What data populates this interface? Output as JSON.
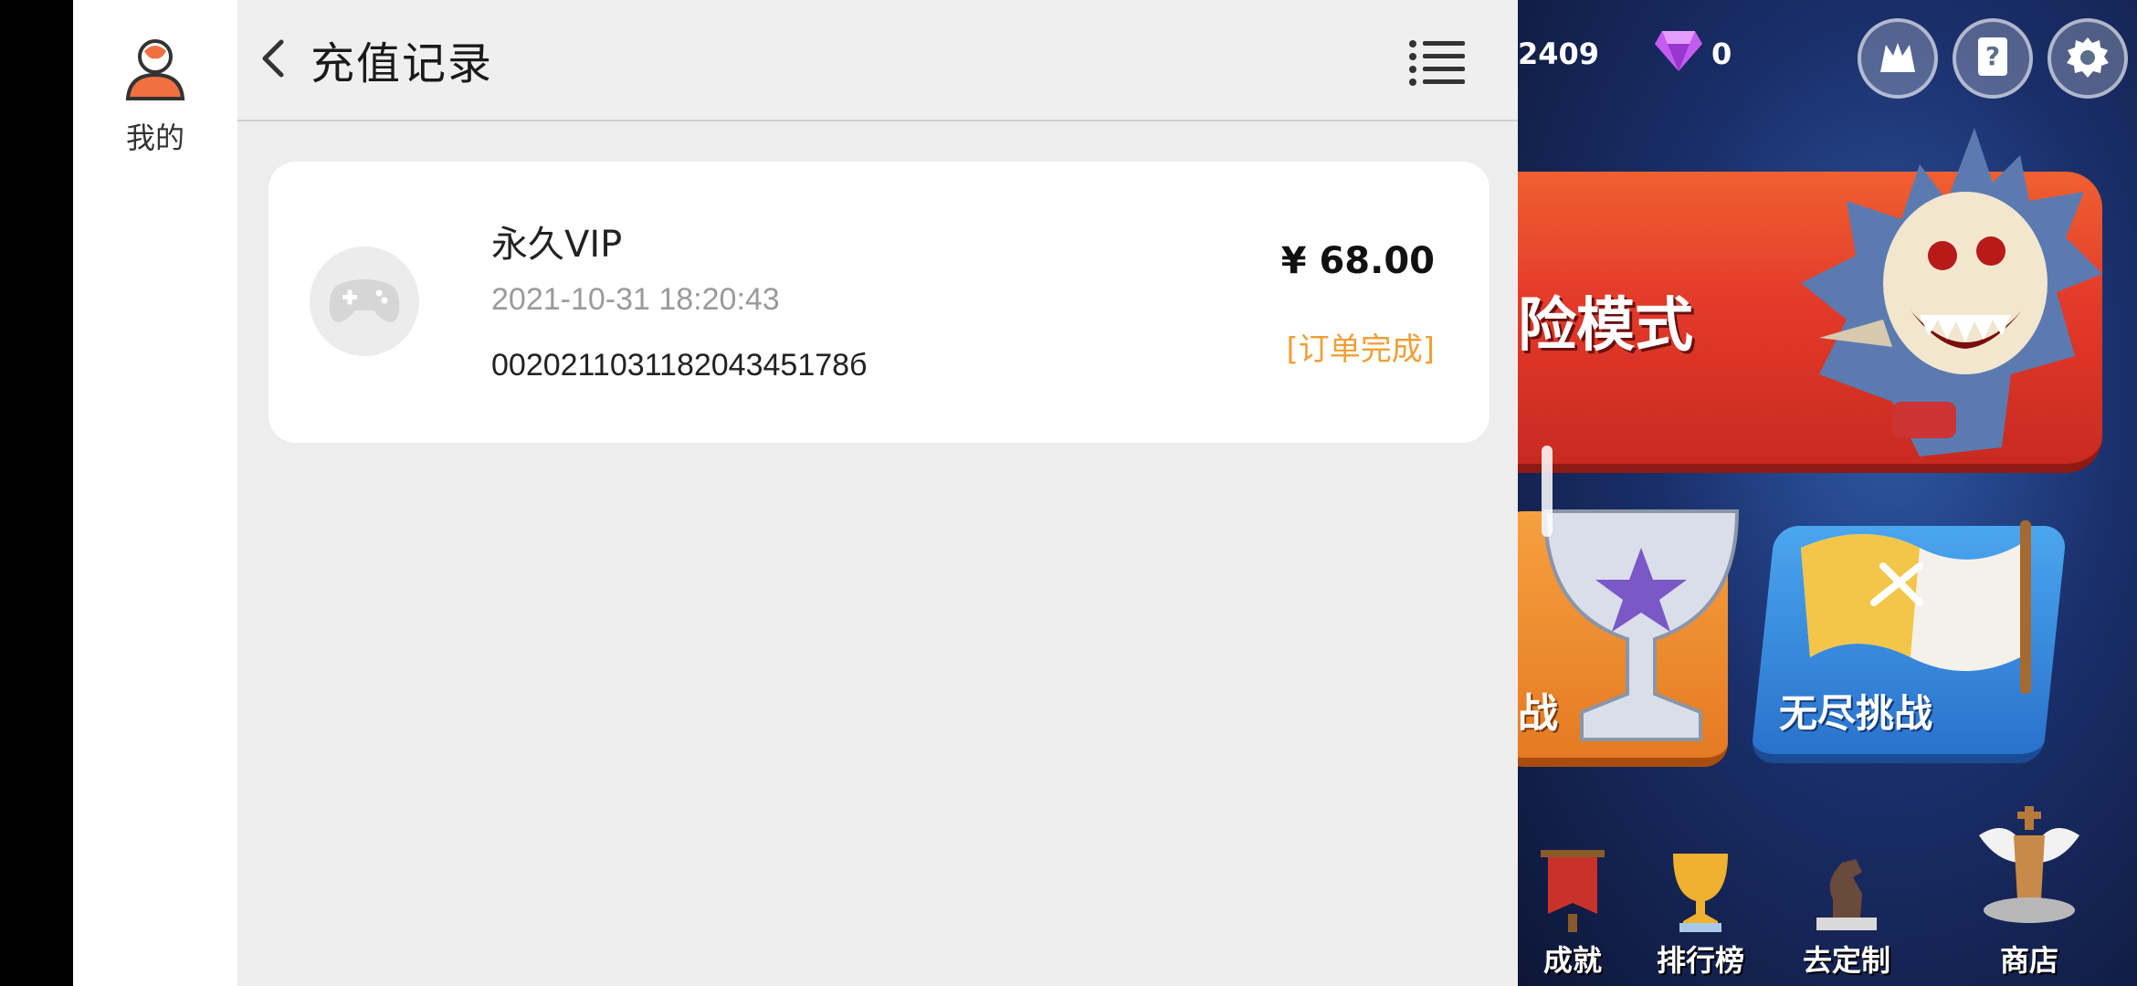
{
  "sidebar": {
    "item_label": "我的"
  },
  "header": {
    "title": "充值记录"
  },
  "record": {
    "name": "永久VIP",
    "time": "2021-10-31 18:20:43",
    "order_no": "002021103118204345178б",
    "amount": "¥ 68.00",
    "status": "[订单完成]"
  },
  "game": {
    "score": "2409",
    "gems": "0",
    "adventure_label": "险模式",
    "trophy_partial": "战",
    "endless_label": "无尽挑战",
    "nav": [
      "成就",
      "排行榜",
      "去定制",
      "商店"
    ]
  },
  "colors": {
    "status_orange": "#f0a038",
    "panel_bg": "#ededed",
    "card_bg": "#ffffff"
  },
  "icons": {
    "avatar": "user-avatar-icon",
    "back": "chevron-left-icon",
    "menu": "list-menu-icon",
    "game": "gamepad-icon",
    "gem": "diamond-icon",
    "settings": "gear-icon",
    "help": "help-card-icon"
  }
}
